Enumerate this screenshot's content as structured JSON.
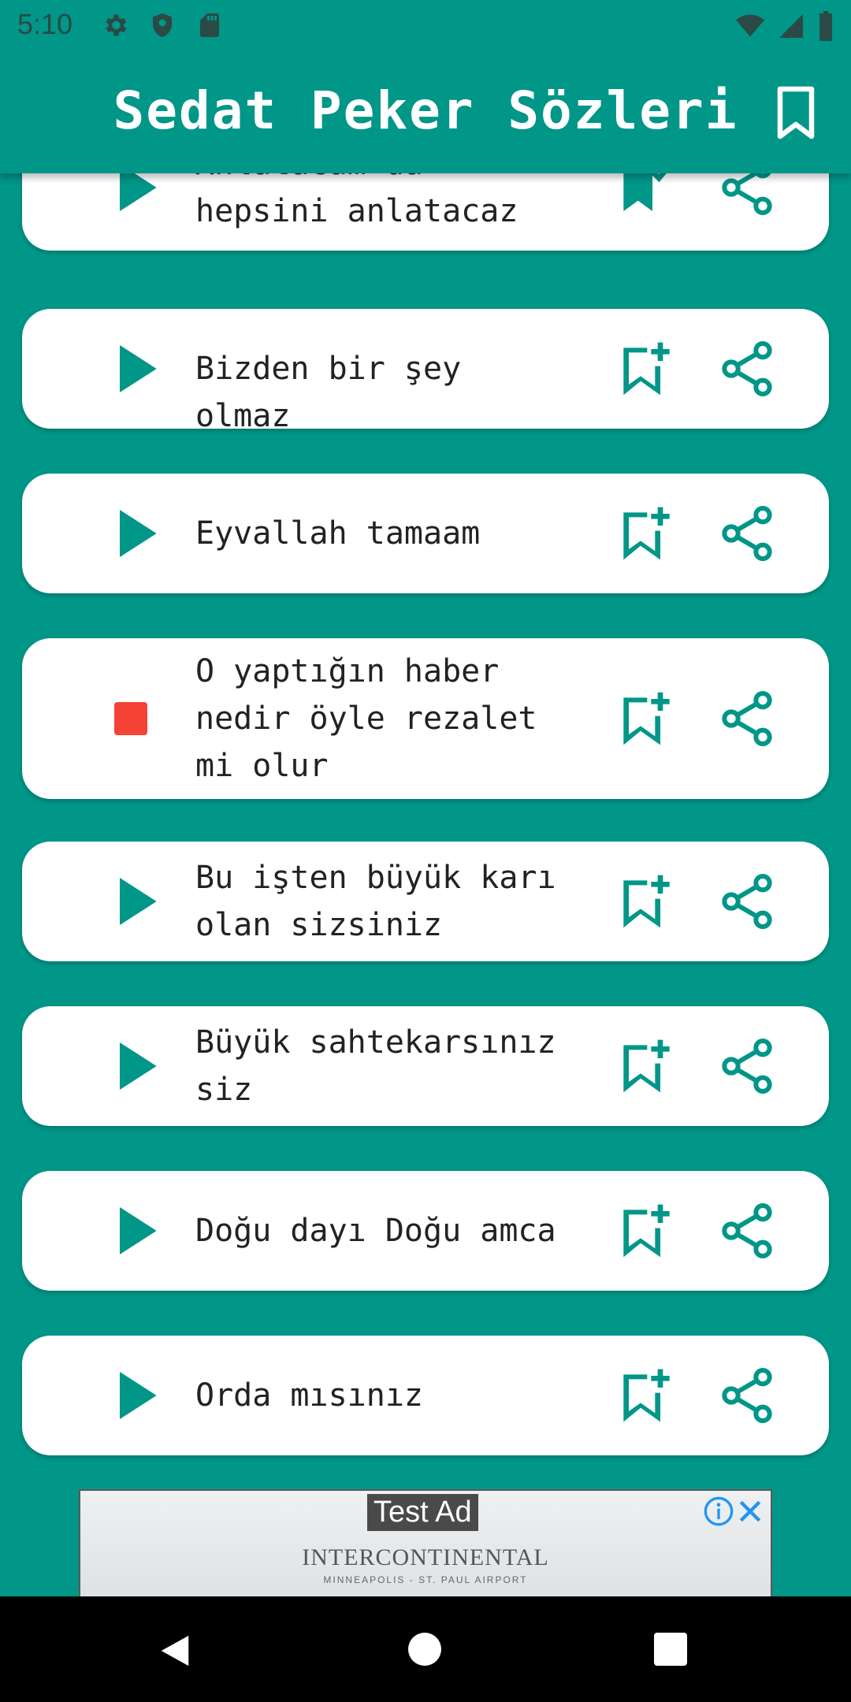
{
  "status": {
    "time": "5:10",
    "icons_left": [
      "gear-icon",
      "shield-icon",
      "sd-card-icon"
    ],
    "icons_right": [
      "wifi-icon",
      "signal-icon",
      "battery-icon"
    ]
  },
  "appbar": {
    "title": "Sedat Peker Sözleri",
    "action_icon": "bookmark-icon"
  },
  "items": [
    {
      "text": "Anlatacam da hepsini anlatacaz",
      "state": "play",
      "bookmarked": true
    },
    {
      "text": "Bizden bir şey olmaz",
      "state": "play",
      "bookmarked": false
    },
    {
      "text": "Eyvallah tamaam",
      "state": "play",
      "bookmarked": false
    },
    {
      "text": "O yaptığın haber nedir öyle rezalet mi olur",
      "state": "stop",
      "bookmarked": false
    },
    {
      "text": "Bu işten büyük karı olan sizsiniz",
      "state": "play",
      "bookmarked": false
    },
    {
      "text": "Büyük sahtekarsınız siz",
      "state": "play",
      "bookmarked": false
    },
    {
      "text": "Doğu dayı Doğu amca",
      "state": "play",
      "bookmarked": false
    },
    {
      "text": "Orda mısınız",
      "state": "play",
      "bookmarked": false
    }
  ],
  "ad": {
    "label": "Test Ad",
    "brand": "INTERCONTINENTAL",
    "subtitle": "MINNEAPOLIS - ST. PAUL AIRPORT"
  },
  "colors": {
    "primary": "#009688",
    "card": "#ffffff",
    "stop": "#f44336"
  }
}
